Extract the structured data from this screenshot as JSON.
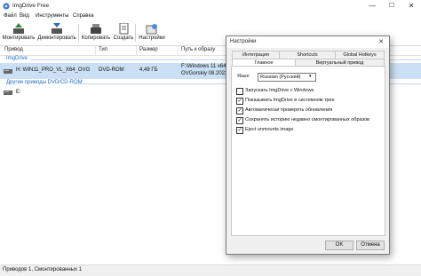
{
  "window": {
    "title": "ImgDrive Free",
    "minimize": "—",
    "maximize": "☐",
    "close": "✕"
  },
  "menu": [
    "Файл",
    "Вид",
    "Инструменты",
    "Справка"
  ],
  "toolbar": {
    "mount": "Монтировать",
    "unmount": "Демонтировать",
    "copy": "Копировать",
    "create": "Создать",
    "settings": "Настройки"
  },
  "columns": [
    "Привод",
    "Тип",
    "Размер",
    "Путь к образу"
  ],
  "groups": {
    "imgdrive": "ImgDrive",
    "other": "Другие приводы DVD/CD-ROM"
  },
  "drives": [
    {
      "name": "H: WIN11_PRO_VL_X64_OVG",
      "type": "DVD-ROM",
      "size": "4,49 ГБ",
      "path1": "F:\\Windows 11 x64 R",
      "path2": "OVGorskiy 08.2022.is"
    },
    {
      "name": "E:"
    }
  ],
  "status": "Приводов 1, Смонтированных 1",
  "dialog": {
    "title": "Настройки",
    "close": "✕",
    "tabs_back": [
      "Интеграция",
      "Shortcuts",
      "Global Hotkeys"
    ],
    "tabs_front": [
      "Главное",
      "Виртуальный привод"
    ],
    "language_label": "Язык:",
    "language_value": "Russian (Русский)",
    "options": [
      {
        "label": "Запускать ImgDrive с Windows",
        "checked": false
      },
      {
        "label": "Показывать ImgDrive в системном трее",
        "checked": true
      },
      {
        "label": "Автоматически проверять обновления",
        "checked": true
      },
      {
        "label": "Сохранять историю недавно смонтированных образов",
        "checked": true
      },
      {
        "label": "Eject unmounts image",
        "checked": true
      }
    ],
    "ok": "OK",
    "cancel": "Отмена"
  }
}
